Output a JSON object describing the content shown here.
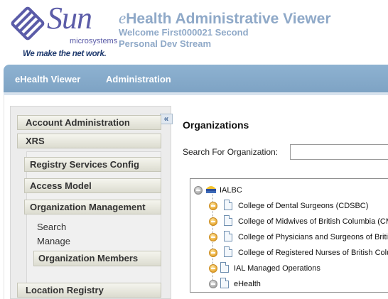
{
  "header": {
    "logo_word": "Sun",
    "logo_sub": "microsystems",
    "logo_tagline": "We make the net work.",
    "title_e": "e",
    "title_rest": "Health Administrative Viewer",
    "welcome": "Welcome First000021 Second",
    "stream": "Personal Dev Stream"
  },
  "nav": {
    "tabs": [
      {
        "label": "eHealth Viewer"
      },
      {
        "label": "Administration"
      }
    ]
  },
  "sidebar": {
    "collapse_glyph": "«",
    "sections": [
      {
        "label": "Account Administration"
      },
      {
        "label": "XRS"
      },
      {
        "label": "Location Registry"
      }
    ],
    "xrs_items": [
      {
        "label": "Registry Services Config"
      },
      {
        "label": "Access Model"
      },
      {
        "label": "Organization Management"
      }
    ],
    "org_mgmt_items": [
      {
        "label": "Search"
      },
      {
        "label": "Manage"
      },
      {
        "label": "Organization Members"
      }
    ]
  },
  "main": {
    "title": "Organizations",
    "search_label": "Search For Organization:",
    "search_value": "",
    "tree": {
      "root": "IALBC",
      "children": [
        {
          "label": "College of Dental Surgeons (CDSBC)"
        },
        {
          "label": "College of Midwives of British Columbia (CM"
        },
        {
          "label": "College of Physicians and Surgeons of Britis"
        },
        {
          "label": "College of Registered Nurses of British Colu"
        },
        {
          "label": "IAL Managed Operations"
        },
        {
          "label": "eHealth"
        }
      ]
    }
  },
  "colors": {
    "brand": "#5b5ca8",
    "title": "#8fa9c8",
    "navbar": "#8eb2d1",
    "expand_plus": "#e8a832"
  }
}
